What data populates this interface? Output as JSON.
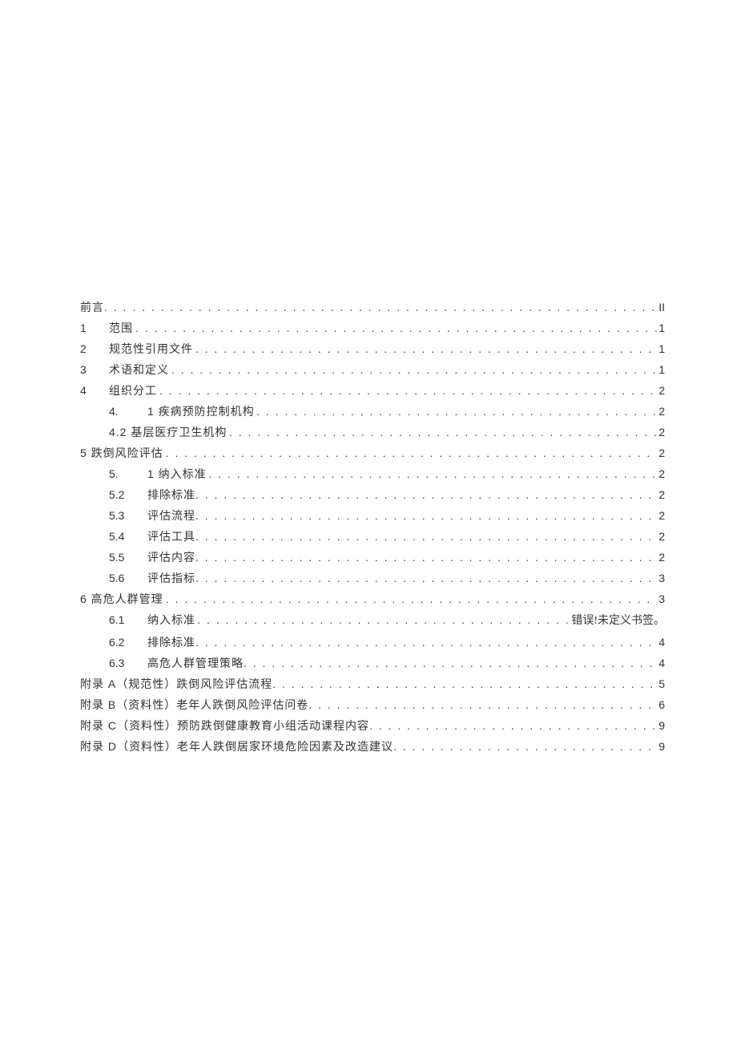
{
  "toc": [
    {
      "level": "lvl0",
      "num": "",
      "label": "前言",
      "page": "II"
    },
    {
      "level": "lvl1",
      "num": "1",
      "label": "范围",
      "page": "1"
    },
    {
      "level": "lvl1",
      "num": "2",
      "label": "规范性引用文件",
      "page": "1"
    },
    {
      "level": "lvl1",
      "num": "3",
      "label": "术语和定义",
      "page": "1"
    },
    {
      "level": "lvl1",
      "num": "4",
      "label": "组织分工",
      "page": "2"
    },
    {
      "level": "lvl2",
      "num": "4.",
      "label": "1 疾病预防控制机构",
      "page": "2"
    },
    {
      "level": "lvl2b",
      "num": "",
      "label": "4.2 基层医疗卫生机构",
      "page": "2"
    },
    {
      "level": "lvl0",
      "num": "",
      "label": "5 跌倒风险评估",
      "page": "2"
    },
    {
      "level": "lvl2",
      "num": "5.",
      "label": "1 纳入标准",
      "page": "2"
    },
    {
      "level": "lvl2",
      "num": "5.2",
      "label": "排除标准",
      "page": "2"
    },
    {
      "level": "lvl2",
      "num": "5.3",
      "label": "评估流程",
      "page": "2"
    },
    {
      "level": "lvl2",
      "num": "5.4",
      "label": "评估工具",
      "page": "2"
    },
    {
      "level": "lvl2",
      "num": "5.5",
      "label": "评估内容",
      "page": "2"
    },
    {
      "level": "lvl2",
      "num": "5.6",
      "label": "评估指标",
      "page": "3"
    },
    {
      "level": "lvl0",
      "num": "",
      "label": "6 高危人群管理",
      "page": "3"
    },
    {
      "level": "lvl2",
      "num": "6.1",
      "label": "纳入标准",
      "page": "错误!未定义书签。"
    },
    {
      "level": "lvl2",
      "num": "6.2",
      "label": "排除标准",
      "page": "4"
    },
    {
      "level": "lvl2",
      "num": "6.3",
      "label": "高危人群管理策略",
      "page": "4"
    },
    {
      "level": "lvl0",
      "num": "",
      "label": "附录 A（规范性）跌倒风险评估流程",
      "page": "5"
    },
    {
      "level": "lvl0",
      "num": "",
      "label": "附录 B（资料性）老年人跌倒风险评估问卷",
      "page": "6"
    },
    {
      "level": "lvl0",
      "num": "",
      "label": "附录 C（资料性）预防跌倒健康教育小组活动课程内容",
      "page": "9"
    },
    {
      "level": "lvl0",
      "num": "",
      "label": "附录 D（资料性）老年人跌倒居家环境危险因素及改造建议",
      "page": "9"
    }
  ],
  "dots": ". . . . . . . . . . . . . . . . . . . . . . . . . . . . . . . . . . . . . . . . . . . . . . . . . . . . . . . . . . . . . . . . . . . . . . . . . . . . . . . . . . . . . . . . . . . . . . . . . . . . . . . . . . . . . . . . . . . . . . . . . . . . . . . . . . . . . . . . . . . ."
}
